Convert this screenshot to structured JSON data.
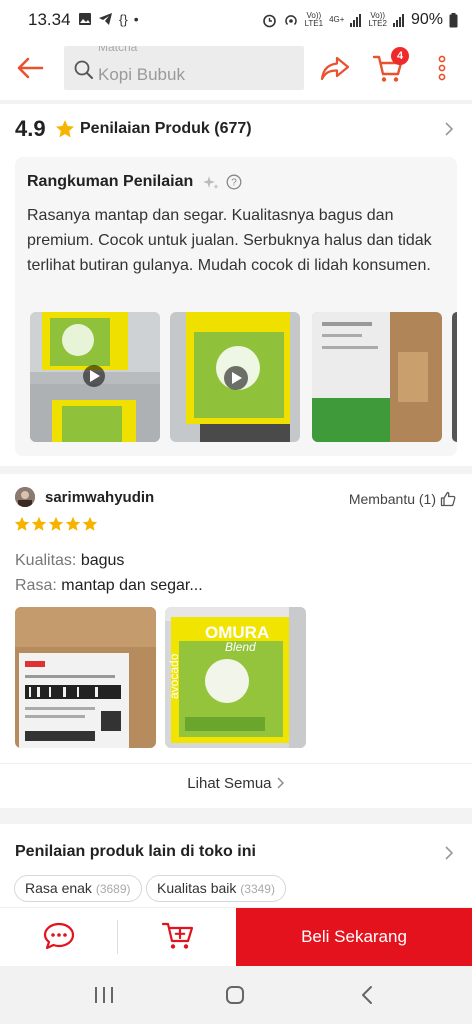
{
  "status": {
    "time": "13.34",
    "battery": "90%",
    "net1": "4G+",
    "sim1": "Vo))\nLTE1",
    "sim2": "Vo))\nLTE2"
  },
  "header": {
    "search_ghost": "Matcha",
    "search_placeholder": "Kopi Bubuk",
    "cart_count": "4"
  },
  "rating": {
    "score": "4.9",
    "title": "Penilaian Produk (677)"
  },
  "summary": {
    "title": "Rangkuman Penilaian",
    "text": "Rasanya mantap dan segar. Kualitasnya bagus dan premium. Cocok untuk jualan. Serbuknya halus dan tidak terlihat butiran gulanya. Mudah cocok di lidah konsumen."
  },
  "review": {
    "user": "sarimwahyudin",
    "helpful": "Membantu (1)",
    "stars": 5,
    "quality_key": "Kualitas:",
    "quality_val": "bagus",
    "taste_key": "Rasa:",
    "taste_val": "mantap dan segar..."
  },
  "product_label": {
    "brand": "OMURA",
    "sub": "Blend",
    "flavor": "avocado"
  },
  "see_all": "Lihat Semua",
  "other": {
    "title": "Penilaian produk lain di toko ini",
    "chips": [
      {
        "label": "Rasa enak",
        "count": "(3689)"
      },
      {
        "label": "Kualitas baik",
        "count": "(3349)"
      }
    ]
  },
  "action": {
    "buy_label": "Beli Sekarang"
  },
  "colors": {
    "accent": "#e4121d",
    "header_icon": "#e8522e",
    "star": "#f6b400"
  }
}
